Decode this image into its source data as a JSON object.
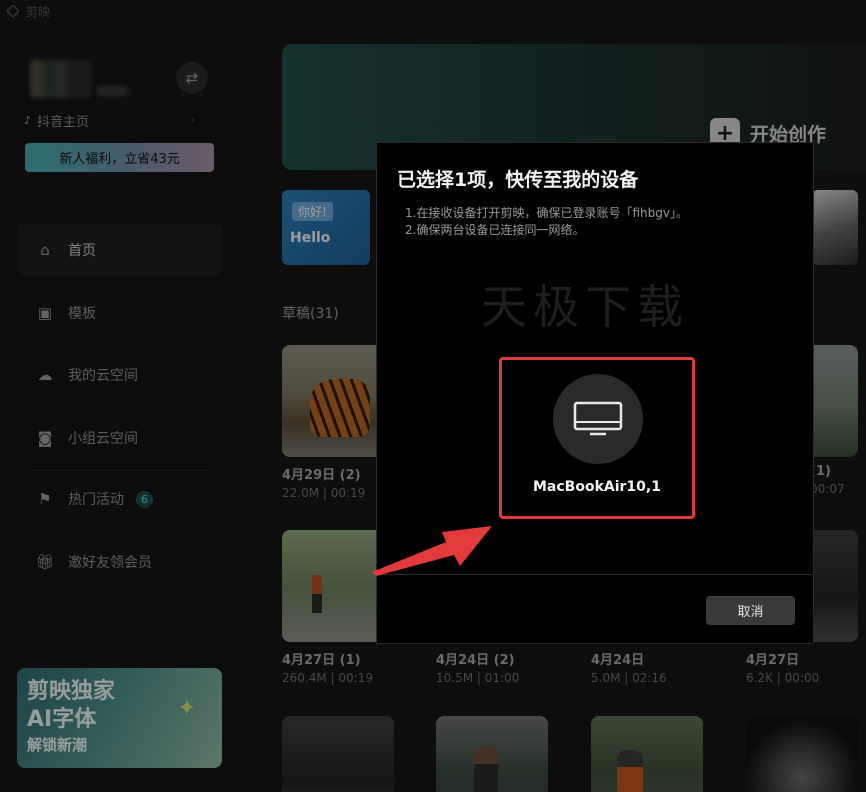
{
  "app": {
    "title": "剪映"
  },
  "sidebar": {
    "douyin_label": "抖音主页",
    "promo": "新人福利，立省43元",
    "nav": [
      {
        "label": "首页",
        "icon": "home-icon",
        "active": true
      },
      {
        "label": "模板",
        "icon": "template-icon"
      },
      {
        "label": "我的云空间",
        "icon": "cloud-icon"
      },
      {
        "label": "小组云空间",
        "icon": "group-cloud-icon"
      },
      {
        "label": "热门活动",
        "icon": "flag-icon",
        "badge": "6"
      },
      {
        "label": "邀好友领会员",
        "icon": "gift-icon"
      }
    ],
    "banner": {
      "line1": "剪映独家",
      "line2": "AI字体",
      "line3": "解锁新潮"
    }
  },
  "main": {
    "hero": {
      "create_label": "开始创作"
    },
    "strip": {
      "tag": "你好!",
      "text": "Hello"
    },
    "drafts_title": "草稿(31)",
    "drafts": [
      {
        "date": "4月29日 (2)",
        "meta": "22.0M | 00:19",
        "thumb": "tiger"
      },
      {
        "date": "(1)",
        "meta": "00:07",
        "thumb": "building"
      },
      {
        "date": "4月27日 (1)",
        "meta": "260.4M | 00:19",
        "thumb": "park"
      },
      {
        "date": "4月24日 (2)",
        "meta": "10.5M | 01:00",
        "thumb": "dark"
      },
      {
        "date": "4月24日",
        "meta": "5.0M | 02:16",
        "thumb": "dark"
      },
      {
        "date": "4月27日",
        "meta": "6.2K | 00:00",
        "thumb": "dark"
      },
      {
        "thumb": "dark"
      },
      {
        "thumb": "street"
      },
      {
        "thumb": "street2"
      },
      {
        "thumb": "vig"
      }
    ]
  },
  "dialog": {
    "title": "已选择1项，快传至我的设备",
    "tip1": "1.在接收设备打开剪映，确保已登录账号「fihbgv」。",
    "tip2": "2.确保两台设备已连接同一网络。",
    "watermark": "天极下载",
    "device_name": "MacBookAir10,1",
    "cancel": "取消"
  },
  "colors": {
    "highlight": "#e33b3b",
    "accent": "#5fd6d6"
  }
}
